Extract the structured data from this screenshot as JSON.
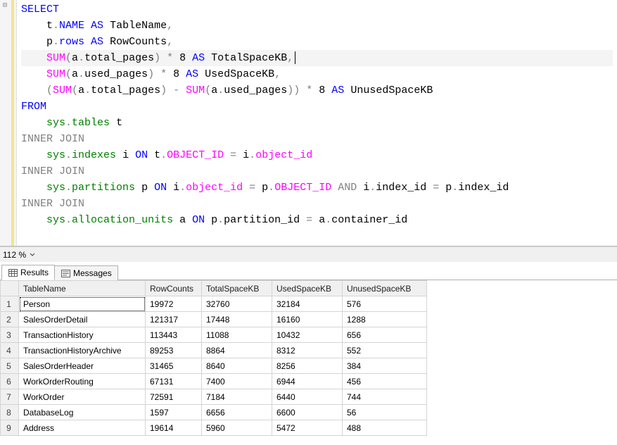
{
  "zoom": {
    "level": "112 %"
  },
  "tabs": {
    "results": "Results",
    "messages": "Messages"
  },
  "sql": {
    "line1_select": "SELECT",
    "line2_pre": "    t",
    "line2_dot": ".",
    "line2_name": "NAME",
    "line2_as": " AS",
    "line2_rest": " TableName",
    "line2_comma": ",",
    "line3_pre": "    p",
    "line3_dot": ".",
    "line3_rows": "rows",
    "line3_as": " AS",
    "line3_rest": " RowCounts",
    "line3_comma": ",",
    "line4_ind": "    ",
    "line4_sum": "SUM",
    "line4_p1": "(",
    "line4_a": "a",
    "line4_dot": ".",
    "line4_tp": "total_pages",
    "line4_p2": ")",
    "line4_mul": " *",
    "line4_8": " 8",
    "line4_as": " AS",
    "line4_rest": " TotalSpaceKB",
    "line4_comma": ",",
    "line5_ind": "    ",
    "line5_sum": "SUM",
    "line5_p1": "(",
    "line5_a": "a",
    "line5_dot": ".",
    "line5_up": "used_pages",
    "line5_p2": ")",
    "line5_mul": " *",
    "line5_8": " 8",
    "line5_as": " AS",
    "line5_rest": " UsedSpaceKB",
    "line5_comma": ",",
    "line6_ind": "    ",
    "line6_p1": "(",
    "line6_sum1": "SUM",
    "line6_p2": "(",
    "line6_a1": "a",
    "line6_dot1": ".",
    "line6_tp": "total_pages",
    "line6_p3": ")",
    "line6_minus": " -",
    "line6_sp": " ",
    "line6_sum2": "SUM",
    "line6_p4": "(",
    "line6_a2": "a",
    "line6_dot2": ".",
    "line6_up": "used_pages",
    "line6_p5": "))",
    "line6_mul": " *",
    "line6_8": " 8",
    "line6_as": " AS",
    "line6_rest": " UnusedSpaceKB",
    "line7_from": "FROM",
    "line8_ind": "    ",
    "line8_sys": "sys",
    "line8_dot": ".",
    "line8_tables": "tables",
    "line8_t": " t",
    "line9_ij": "INNER",
    "line9_join": " JOIN",
    "line10_ind": "    ",
    "line10_sys": "sys",
    "line10_dot": ".",
    "line10_idx": "indexes",
    "line10_i": " i",
    "line10_on": " ON",
    "line10_t": " t",
    "line10_d2": ".",
    "line10_oid": "OBJECT_ID",
    "line10_eq": " =",
    "line10_i2": " i",
    "line10_d3": ".",
    "line10_oid2": "object_id",
    "line11_ij": "INNER",
    "line11_join": " JOIN",
    "line12_ind": "    ",
    "line12_sys": "sys",
    "line12_dot": ".",
    "line12_part": "partitions",
    "line12_p": " p",
    "line12_on": " ON",
    "line12_i": " i",
    "line12_d2": ".",
    "line12_oid": "object_id",
    "line12_eq": " =",
    "line12_p2": " p",
    "line12_d3": ".",
    "line12_oid2": "OBJECT_ID",
    "line12_and": " AND",
    "line12_i2": " i",
    "line12_d4": ".",
    "line12_iid": "index_id",
    "line12_eq2": " =",
    "line12_p3": " p",
    "line12_d5": ".",
    "line12_iid2": "index_id",
    "line13_ij": "INNER",
    "line13_join": " JOIN",
    "line14_ind": "    ",
    "line14_sys": "sys",
    "line14_dot": ".",
    "line14_au": "allocation_units",
    "line14_a": " a",
    "line14_on": " ON",
    "line14_p": " p",
    "line14_d2": ".",
    "line14_pid": "partition_id",
    "line14_eq": " =",
    "line14_a2": " a",
    "line14_d3": ".",
    "line14_cid": "container_id"
  },
  "grid": {
    "headers": {
      "tablename": "TableName",
      "rowcounts": "RowCounts",
      "total": "TotalSpaceKB",
      "used": "UsedSpaceKB",
      "unused": "UnusedSpaceKB"
    },
    "rows": [
      {
        "n": "1",
        "tablename": "Person",
        "rowcounts": "19972",
        "total": "32760",
        "used": "32184",
        "unused": "576"
      },
      {
        "n": "2",
        "tablename": "SalesOrderDetail",
        "rowcounts": "121317",
        "total": "17448",
        "used": "16160",
        "unused": "1288"
      },
      {
        "n": "3",
        "tablename": "TransactionHistory",
        "rowcounts": "113443",
        "total": "11088",
        "used": "10432",
        "unused": "656"
      },
      {
        "n": "4",
        "tablename": "TransactionHistoryArchive",
        "rowcounts": "89253",
        "total": "8864",
        "used": "8312",
        "unused": "552"
      },
      {
        "n": "5",
        "tablename": "SalesOrderHeader",
        "rowcounts": "31465",
        "total": "8640",
        "used": "8256",
        "unused": "384"
      },
      {
        "n": "6",
        "tablename": "WorkOrderRouting",
        "rowcounts": "67131",
        "total": "7400",
        "used": "6944",
        "unused": "456"
      },
      {
        "n": "7",
        "tablename": "WorkOrder",
        "rowcounts": "72591",
        "total": "7184",
        "used": "6440",
        "unused": "744"
      },
      {
        "n": "8",
        "tablename": "DatabaseLog",
        "rowcounts": "1597",
        "total": "6656",
        "used": "6600",
        "unused": "56"
      },
      {
        "n": "9",
        "tablename": "Address",
        "rowcounts": "19614",
        "total": "5960",
        "used": "5472",
        "unused": "488"
      }
    ]
  },
  "chart_data": {
    "type": "table",
    "title": "",
    "columns": [
      "TableName",
      "RowCounts",
      "TotalSpaceKB",
      "UsedSpaceKB",
      "UnusedSpaceKB"
    ],
    "rows": [
      [
        "Person",
        19972,
        32760,
        32184,
        576
      ],
      [
        "SalesOrderDetail",
        121317,
        17448,
        16160,
        1288
      ],
      [
        "TransactionHistory",
        113443,
        11088,
        10432,
        656
      ],
      [
        "TransactionHistoryArchive",
        89253,
        8864,
        8312,
        552
      ],
      [
        "SalesOrderHeader",
        31465,
        8640,
        8256,
        384
      ],
      [
        "WorkOrderRouting",
        67131,
        7400,
        6944,
        456
      ],
      [
        "WorkOrder",
        72591,
        7184,
        6440,
        744
      ],
      [
        "DatabaseLog",
        1597,
        6656,
        6600,
        56
      ],
      [
        "Address",
        19614,
        5960,
        5472,
        488
      ]
    ]
  }
}
